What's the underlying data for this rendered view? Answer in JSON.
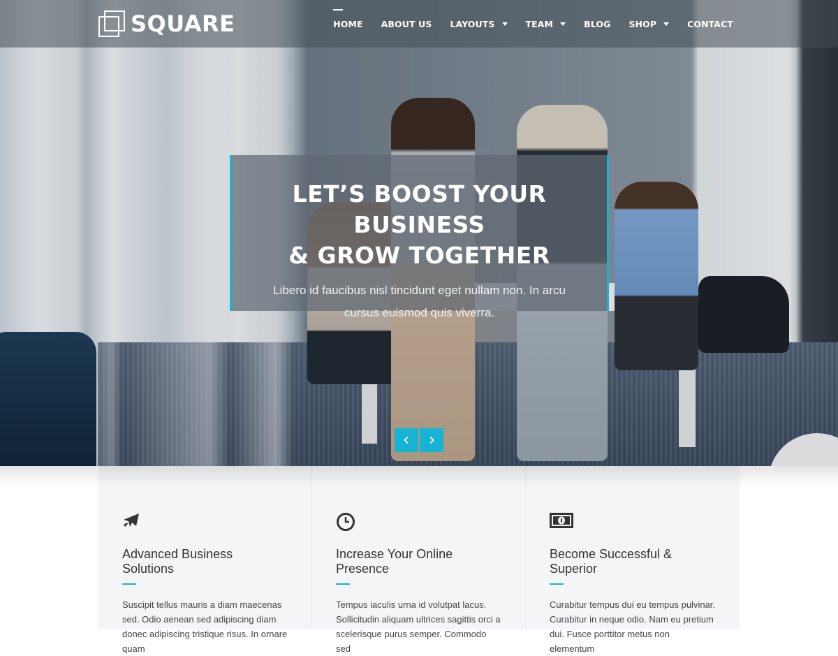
{
  "header": {
    "logo_text": "SQUARE",
    "nav": [
      {
        "label": "HOME",
        "active": true,
        "dropdown": false
      },
      {
        "label": "ABOUT US",
        "active": false,
        "dropdown": false
      },
      {
        "label": "LAYOUTS",
        "active": false,
        "dropdown": true
      },
      {
        "label": "TEAM",
        "active": false,
        "dropdown": true
      },
      {
        "label": "BLOG",
        "active": false,
        "dropdown": false
      },
      {
        "label": "SHOP",
        "active": false,
        "dropdown": true
      },
      {
        "label": "CONTACT",
        "active": false,
        "dropdown": false
      }
    ]
  },
  "hero": {
    "title_line1": "LET’S BOOST YOUR BUSINESS",
    "title_line2": "& GROW TOGETHER",
    "text": "Libero id faucibus nisl tincidunt eget nullam non. In arcu cursus euismod quis viverra.",
    "prev_icon": "chevron-left-icon",
    "next_icon": "chevron-right-icon"
  },
  "features": [
    {
      "icon": "airplane-icon",
      "title": "Advanced Business Solutions",
      "text": "Suscipit tellus mauris a diam maecenas sed. Odio aenean sed adipiscing diam donec adipiscing tristique risus. In ornare quam"
    },
    {
      "icon": "clock-icon",
      "title": "Increase Your Online Presence",
      "text": "Tempus iaculis urna id volutpat lacus. Sollicitudin aliquam ultrices sagittis orci a scelerisque purus semper. Commodo sed"
    },
    {
      "icon": "money-icon",
      "title": "Become Successful & Superior",
      "text": "Curabitur tempus dui eu tempus pulvinar. Curabitur in neque odio. Nam eu pretium dui. Fusce porttitor metus non elementum"
    }
  ],
  "colors": {
    "accent": "#17b3d3",
    "header_bg": "#464e56",
    "feature_bg": "#f4f5f7",
    "text_dark": "#333333"
  }
}
